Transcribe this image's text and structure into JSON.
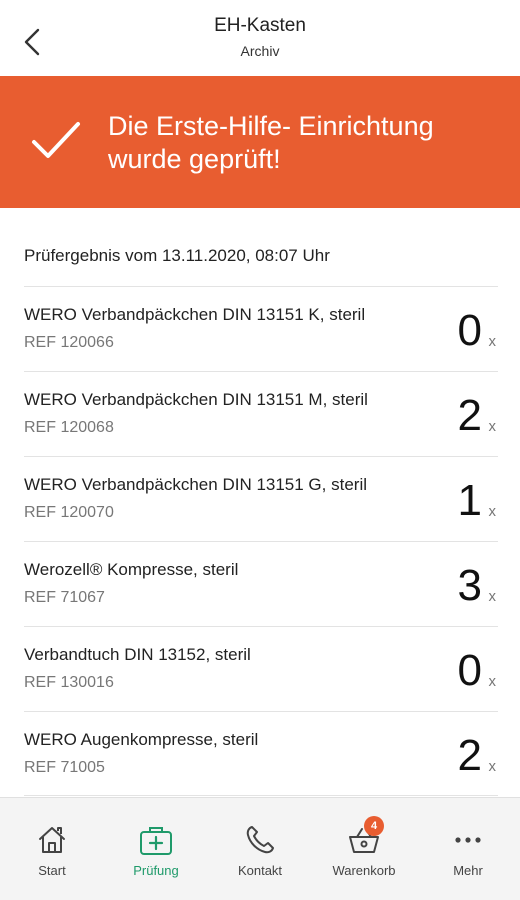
{
  "header": {
    "title": "EH-Kasten",
    "subtitle": "Archiv"
  },
  "banner": {
    "text": "Die Erste-Hilfe- Einrichtung wurde geprüft!",
    "color": "#e85d30"
  },
  "result": {
    "title": "Prüfergebnis vom 13.11.2020, 08:07 Uhr"
  },
  "items": [
    {
      "name": "WERO Verbandpäckchen DIN 13151 K, steril",
      "ref": "REF 120066",
      "qty": "0",
      "unit": "x"
    },
    {
      "name": "WERO Verbandpäckchen DIN 13151 M, steril",
      "ref": "REF 120068",
      "qty": "2",
      "unit": "x"
    },
    {
      "name": "WERO Verbandpäckchen DIN 13151 G, steril",
      "ref": "REF 120070",
      "qty": "1",
      "unit": "x"
    },
    {
      "name": "Werozell® Kompresse, steril",
      "ref": "REF 71067",
      "qty": "3",
      "unit": "x"
    },
    {
      "name": "Verbandtuch DIN 13152, steril",
      "ref": "REF 130016",
      "qty": "0",
      "unit": "x"
    },
    {
      "name": "WERO Augenkompresse, steril",
      "ref": "REF 71005",
      "qty": "2",
      "unit": "x"
    }
  ],
  "nav": {
    "start": "Start",
    "pruefung": "Prüfung",
    "kontakt": "Kontakt",
    "warenkorb": "Warenkorb",
    "warenkorb_badge": "4",
    "mehr": "Mehr",
    "active_color": "#1f9a6a"
  }
}
